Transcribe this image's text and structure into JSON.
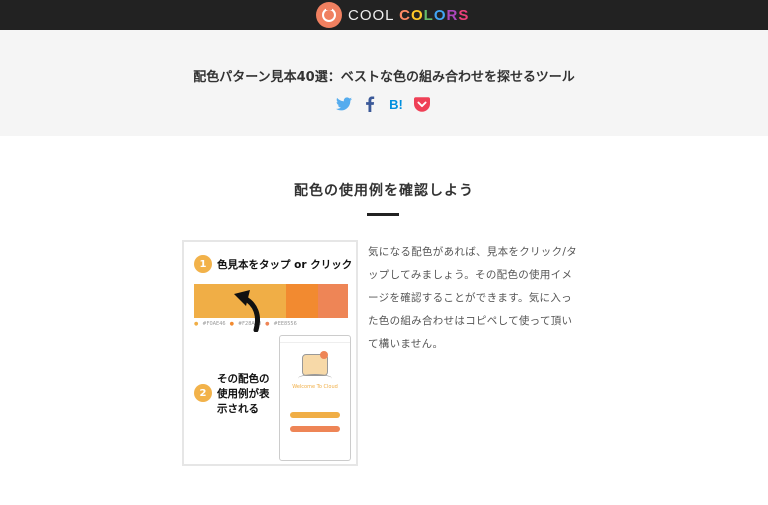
{
  "brand": {
    "name_part1": "COOL",
    "name_part2": "COLORS"
  },
  "hero": {
    "title": "配色パターン見本40選：ベストな色の組み合わせを探せるツール"
  },
  "share": {
    "icons": [
      "twitter-icon",
      "facebook-icon",
      "hatena-bookmark-icon",
      "pocket-icon"
    ],
    "hatena_label": "B!"
  },
  "section": {
    "title": "配色の使用例を確認しよう",
    "body": "気になる配色があれば、見本をクリック/タップしてみましょう。その配色の使用イメージを確認することができます。気に入った色の組み合わせはコピペして使って頂いて構いません。"
  },
  "figure": {
    "step1_num": "1",
    "step1_label": "色見本をタップ or クリック",
    "step2_num": "2",
    "step2_label": "その配色の使用例が表示される",
    "swatches": [
      "#f0ae46",
      "#f28a30",
      "#ee8556"
    ],
    "swatch_codes": [
      "#F0AE46",
      "#F28A30",
      "#EE8556"
    ],
    "phone_welcome": "Welcome To Cloud"
  },
  "colors": {
    "topbar": "#222222",
    "hero_bg": "#f5f5f5",
    "accent_orange": "#f2b24a",
    "twitter": "#55acee",
    "facebook": "#3b5998",
    "hatena": "#008fde",
    "pocket": "#ef4056"
  }
}
